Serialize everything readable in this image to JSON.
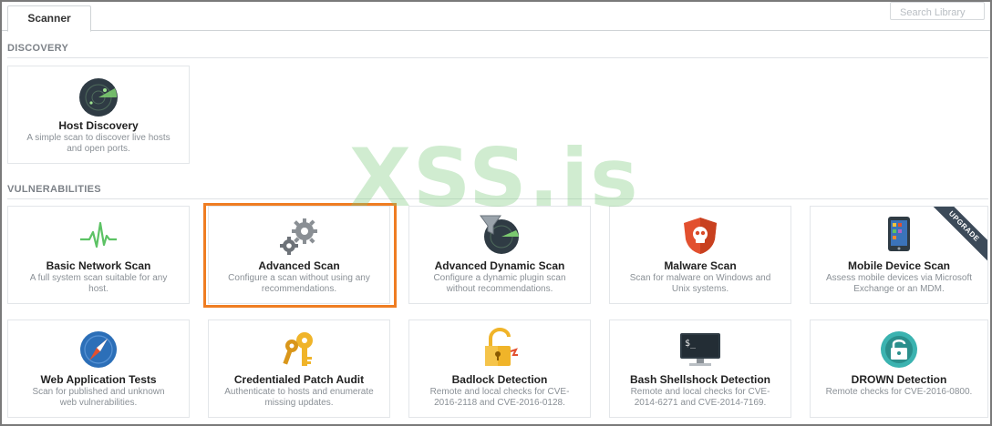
{
  "tabs": [
    {
      "label": "Scanner"
    }
  ],
  "search": {
    "placeholder": "Search Library"
  },
  "sections": {
    "discovery": "DISCOVERY",
    "vulnerabilities": "VULNERABILITIES"
  },
  "cards": {
    "host_discovery": {
      "title": "Host Discovery",
      "desc": "A simple scan to discover live hosts and open ports."
    },
    "basic_network": {
      "title": "Basic Network Scan",
      "desc": "A full system scan suitable for any host."
    },
    "advanced": {
      "title": "Advanced Scan",
      "desc": "Configure a scan without using any recommendations."
    },
    "advanced_dynamic": {
      "title": "Advanced Dynamic Scan",
      "desc": "Configure a dynamic plugin scan without recommendations."
    },
    "malware": {
      "title": "Malware Scan",
      "desc": "Scan for malware on Windows and Unix systems."
    },
    "mobile": {
      "title": "Mobile Device Scan",
      "desc": "Assess mobile devices via Microsoft Exchange or an MDM.",
      "badge": "UPGRADE"
    },
    "web_app": {
      "title": "Web Application Tests",
      "desc": "Scan for published and unknown web vulnerabilities."
    },
    "patch_audit": {
      "title": "Credentialed Patch Audit",
      "desc": "Authenticate to hosts and enumerate missing updates."
    },
    "badlock": {
      "title": "Badlock Detection",
      "desc": "Remote and local checks for CVE-2016-2118 and CVE-2016-0128."
    },
    "shellshock": {
      "title": "Bash Shellshock Detection",
      "desc": "Remote and local checks for CVE-2014-6271 and CVE-2014-7169."
    },
    "drown": {
      "title": "DROWN Detection",
      "desc": "Remote checks for CVE-2016-0800."
    }
  },
  "icons": {
    "host_discovery": "radar-icon",
    "basic_network": "heartbeat-icon",
    "advanced": "gears-icon",
    "advanced_dynamic": "funnel-radar-icon",
    "malware": "skull-shield-icon",
    "mobile": "mobile-phone-icon",
    "web_app": "compass-icon",
    "patch_audit": "keys-icon",
    "badlock": "padlock-icon",
    "shellshock": "terminal-icon",
    "drown": "drown-lock-icon"
  },
  "colors": {
    "selection": "#ef7d22",
    "ribbon": "#3c4a59"
  },
  "watermark": "XSS.is"
}
